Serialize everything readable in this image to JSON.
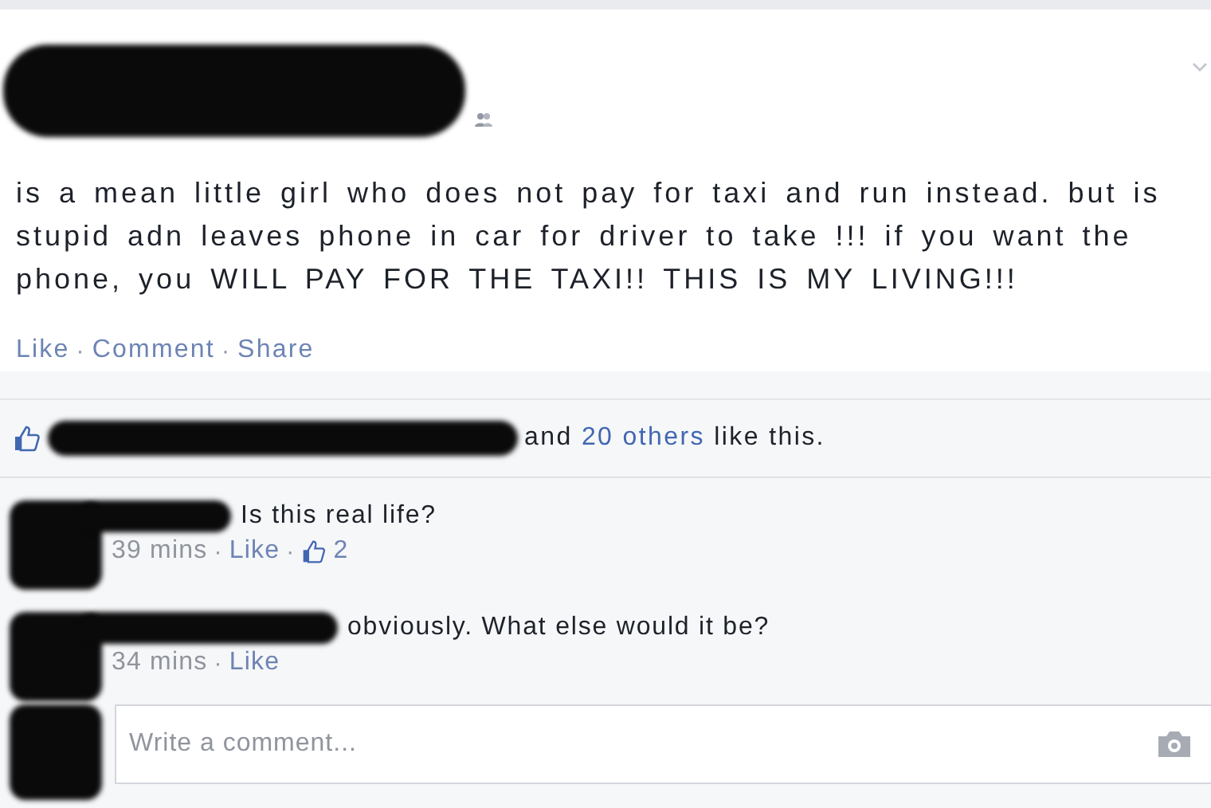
{
  "post": {
    "text": "is a mean little girl who does not pay for taxi and run instead. but is stupid adn leaves phone in car for driver to take !!! if you want the phone, you WILL PAY FOR THE TAXI!! THIS IS MY LIVING!!!",
    "actions": [
      "Like",
      "Comment",
      "Share"
    ]
  },
  "separator": "·",
  "likes": {
    "prefix": "and",
    "link": "20 others",
    "suffix": "like this."
  },
  "comments": [
    {
      "text": "Is this real life?",
      "time": "39 mins",
      "actions": [
        "Like"
      ],
      "like_count": "2"
    },
    {
      "text": "obviously. What else would it be?",
      "time": "34 mins",
      "actions": [
        "Like"
      ]
    }
  ],
  "composer": {
    "placeholder": "Write a comment..."
  }
}
